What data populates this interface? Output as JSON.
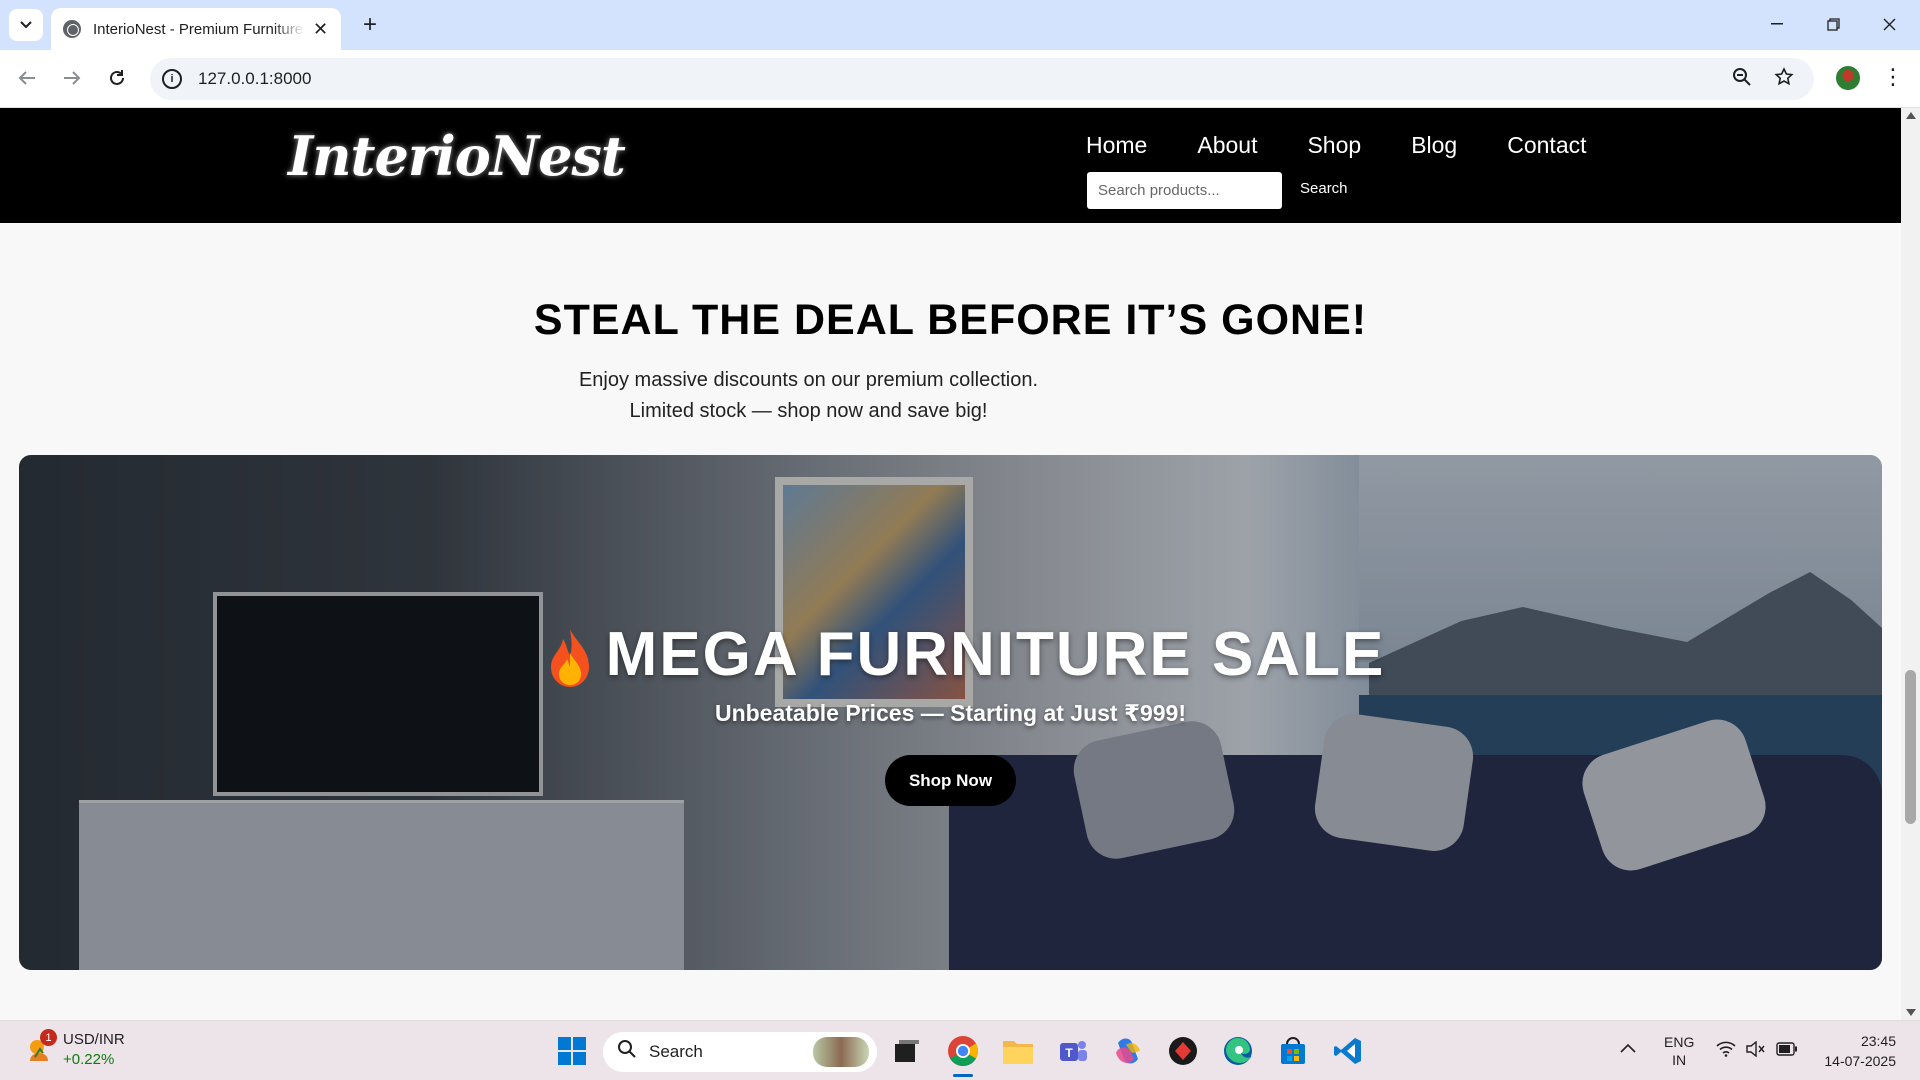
{
  "browser": {
    "tab_title": "InterioNest - Premium Furniture",
    "url": "127.0.0.1:8000"
  },
  "site": {
    "logo": "InterioNest",
    "nav": [
      "Home",
      "About",
      "Shop",
      "Blog",
      "Contact"
    ],
    "search_placeholder": "Search products...",
    "search_button": "Search"
  },
  "deal": {
    "title": "STEAL THE DEAL BEFORE IT’S GONE!",
    "line1": "Enjoy massive discounts on our premium collection.",
    "line2": "Limited stock — shop now and save big!"
  },
  "hero": {
    "title": "MEGA FURNITURE SALE",
    "subtitle": "Unbeatable Prices — Starting at Just ₹999!",
    "cta": "Shop Now"
  },
  "taskbar": {
    "weather_badge": "1",
    "ticker_name": "USD/INR",
    "ticker_change": "+0.22%",
    "search_label": "Search",
    "lang_line1": "ENG",
    "lang_line2": "IN",
    "time": "23:45",
    "date": "14-07-2025"
  },
  "colors": {
    "header_bg": "#000000",
    "tabbar_bg": "#d3e3fd",
    "taskbar_bg": "#ede4ea",
    "ticker_positive": "#0f7b0f"
  }
}
